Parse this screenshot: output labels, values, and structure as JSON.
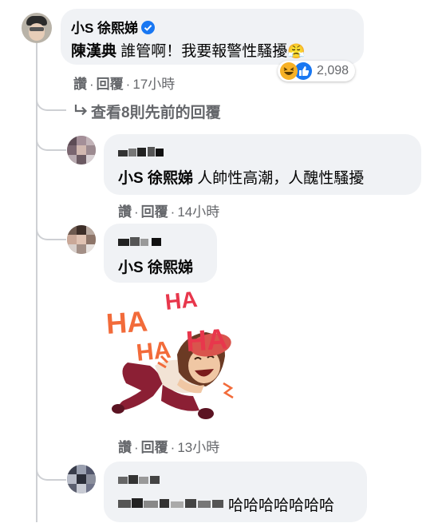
{
  "comment_main": {
    "author": "小S 徐熙娣",
    "mention": "陳漢典",
    "text": " 誰管啊！我要報警性騷擾",
    "emoji": "😤",
    "reaction_count": "2,098",
    "actions": {
      "like": "讚",
      "reply": "回覆",
      "time": "17小時"
    }
  },
  "view_previous": "查看8則先前的回覆",
  "reply_1": {
    "mention": "小S 徐熙娣",
    "text": " 人帥性高潮，人醜性騷擾",
    "actions": {
      "like": "讚",
      "reply": "回覆",
      "time": "14小時"
    }
  },
  "reply_2": {
    "mention": "小S 徐熙娣",
    "sticker_words": [
      "HA",
      "HA",
      "HA",
      "HA"
    ],
    "actions": {
      "like": "讚",
      "reply": "回覆",
      "time": "13小時"
    }
  },
  "reply_3": {
    "text": "哈哈哈哈哈哈哈"
  },
  "colors": {
    "bubble": "#f0f2f5",
    "meta": "#65676b",
    "verified": "#1877f2",
    "sticker_orange": "#f26b3a",
    "sticker_red": "#e8374c"
  }
}
